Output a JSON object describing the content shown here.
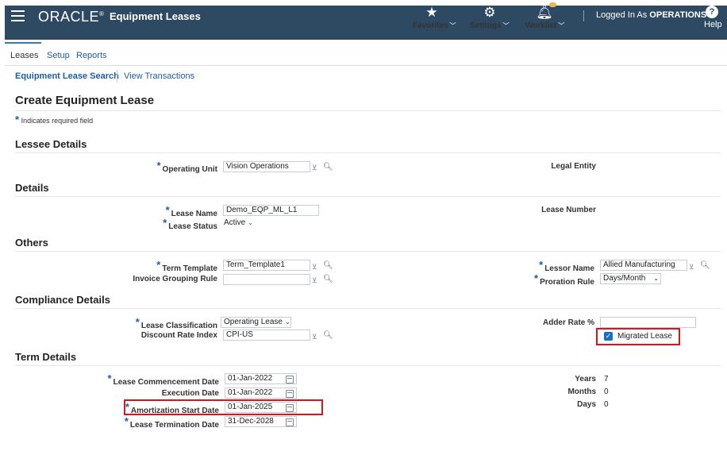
{
  "header": {
    "brand": "ORACLE",
    "app_title": "Equipment Leases",
    "nav": {
      "favorites": "Favorites",
      "settings": "Settings",
      "worklist": "Worklist"
    },
    "logged_prefix": "Logged In As",
    "logged_user": "OPERATIONS",
    "help": "Help"
  },
  "tabs": [
    "Leases",
    "Setup",
    "Reports"
  ],
  "subnav": {
    "search": "Equipment Lease Search",
    "transactions": "View Transactions"
  },
  "page": {
    "title": "Create Equipment Lease",
    "required_note": "Indicates required field"
  },
  "sections": {
    "lessee": "Lessee Details",
    "details": "Details",
    "others": "Others",
    "compliance": "Compliance Details",
    "term": "Term Details"
  },
  "lessee": {
    "operating_unit_label": "Operating Unit",
    "operating_unit_value": "Vision Operations",
    "legal_entity_label": "Legal Entity"
  },
  "details": {
    "lease_name_label": "Lease Name",
    "lease_name_value": "Demo_EQP_ML_L1",
    "lease_status_label": "Lease Status",
    "lease_status_value": "Active",
    "lease_number_label": "Lease Number"
  },
  "others": {
    "term_template_label": "Term Template",
    "term_template_value": "Term_Template1",
    "invoice_grouping_label": "Invoice Grouping Rule",
    "invoice_grouping_value": "",
    "lessor_name_label": "Lessor Name",
    "lessor_name_value": "Allied Manufacturing",
    "proration_rule_label": "Proration Rule",
    "proration_rule_value": "Days/Month"
  },
  "compliance": {
    "lease_classification_label": "Lease Classification",
    "lease_classification_value": "Operating Lease",
    "discount_rate_label": "Discount Rate Index",
    "discount_rate_value": "CPI-US",
    "adder_rate_label": "Adder Rate %",
    "adder_rate_value": "",
    "migrated_lease_label": "Migrated Lease",
    "migrated_lease_checked": true
  },
  "term": {
    "commencement_label": "Lease Commencement Date",
    "commencement_value": "01-Jan-2022",
    "execution_label": "Execution Date",
    "execution_value": "01-Jan-2022",
    "amortization_label": "Amortization Start Date",
    "amortization_value": "01-Jan-2025",
    "termination_label": "Lease Termination Date",
    "termination_value": "31-Dec-2028",
    "years_label": "Years",
    "years_value": "7",
    "months_label": "Months",
    "months_value": "0",
    "days_label": "Days",
    "days_value": "0"
  },
  "colors": {
    "header_bg": "#2e4a62",
    "link": "#1f5ca8",
    "highlight": "#d8141e",
    "checkbox": "#1a6fc3"
  }
}
